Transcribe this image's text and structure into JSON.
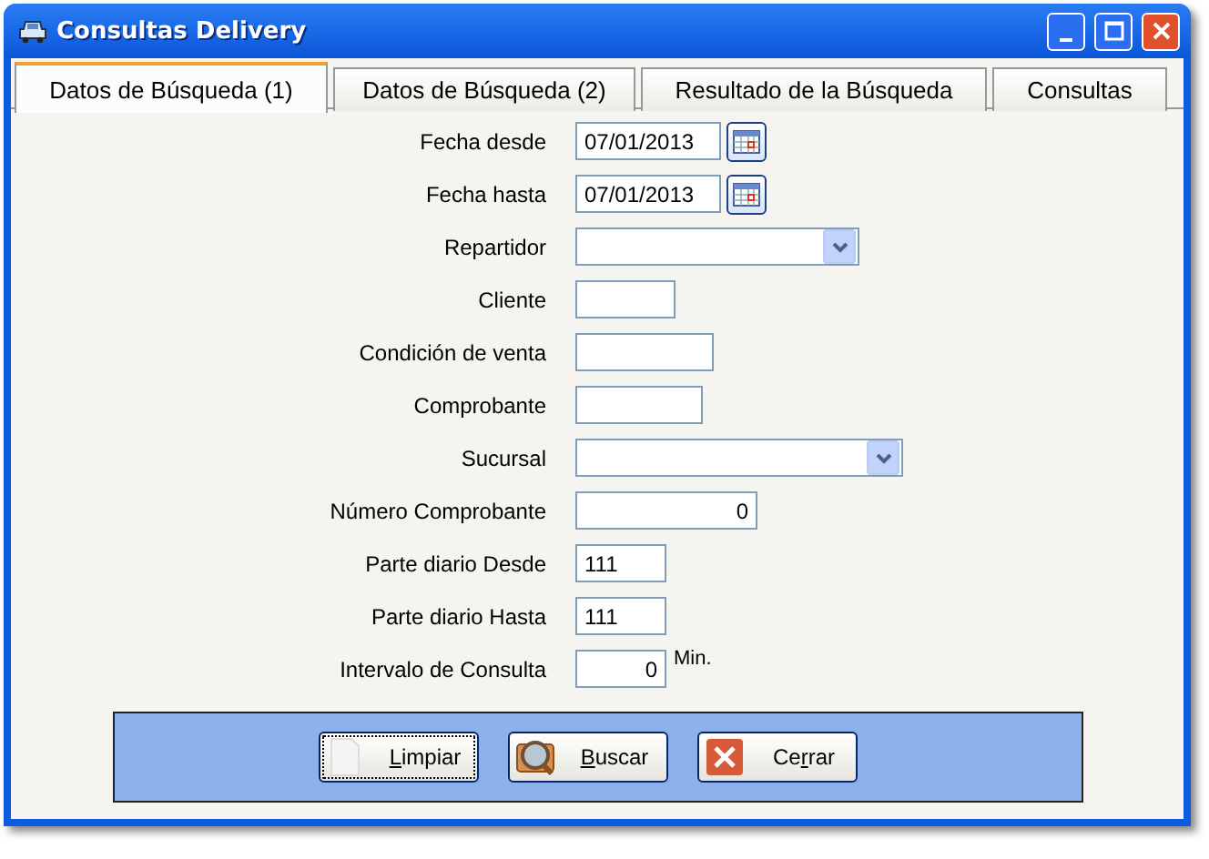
{
  "window": {
    "title": "Consultas Delivery"
  },
  "tabs": [
    {
      "label": "Datos de Búsqueda (1)",
      "selected": true
    },
    {
      "label": "Datos de Búsqueda (2)",
      "selected": false
    },
    {
      "label": "Resultado de la Búsqueda",
      "selected": false
    },
    {
      "label": "Consultas",
      "selected": false
    }
  ],
  "fields": [
    {
      "label": "Fecha desde",
      "kind": "date",
      "value": "07/01/2013"
    },
    {
      "label": "Fecha hasta",
      "kind": "date",
      "value": "07/01/2013"
    },
    {
      "label": "Repartidor",
      "kind": "select"
    },
    {
      "label": "Cliente",
      "kind": "text"
    },
    {
      "label": "Condición de venta",
      "kind": "text"
    },
    {
      "label": "Comprobante",
      "kind": "text"
    },
    {
      "label": "Sucursal",
      "kind": "select"
    },
    {
      "label": "Número Comprobante",
      "kind": "number",
      "value": "0"
    },
    {
      "label": "Parte diario Desde",
      "kind": "text",
      "value": "111"
    },
    {
      "label": "Parte diario Hasta",
      "kind": "text",
      "value": "111"
    },
    {
      "label": "Intervalo de Consulta",
      "kind": "number",
      "value": "0",
      "unit": "Min."
    }
  ],
  "buttons": [
    {
      "label": [
        {
          "text": "L",
          "mnemonic": true
        },
        {
          "text": "impiar",
          "mnemonic": false
        }
      ],
      "kind": "clear",
      "focused": true
    },
    {
      "label": [
        {
          "text": "B",
          "mnemonic": true
        },
        {
          "text": "uscar",
          "mnemonic": false
        }
      ],
      "kind": "search",
      "focused": false
    },
    {
      "label": [
        {
          "text": "Ce",
          "mnemonic": false
        },
        {
          "text": "r",
          "mnemonic": true
        },
        {
          "text": "rar",
          "mnemonic": false
        }
      ],
      "kind": "close",
      "focused": false
    }
  ]
}
